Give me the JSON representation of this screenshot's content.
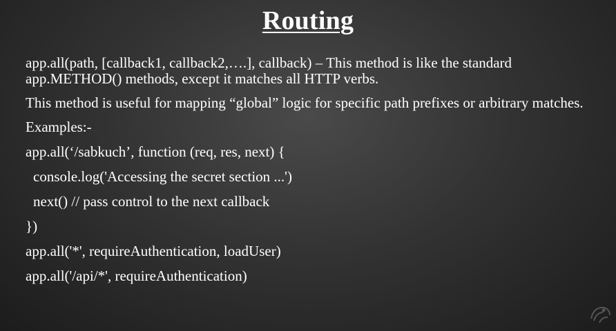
{
  "slide": {
    "title": "Routing",
    "para1": "app.all(path, [callback1, callback2,….], callback) – This method is like the standard app.METHOD() methods, except it matches all HTTP verbs.",
    "para2": "This method is useful for mapping “global” logic for specific path prefixes or arbitrary matches.",
    "examples_label": "Examples:-",
    "code_lines": [
      "app.all(‘/sabkuch’, function (req, res, next) {",
      "console.log('Accessing the secret section ...')",
      "next() // pass control to the next callback",
      "})",
      "app.all('*', requireAuthentication, loadUser)",
      "app.all('/api/*', requireAuthentication)"
    ]
  },
  "icons": {
    "logo": "lion-logo-icon"
  }
}
